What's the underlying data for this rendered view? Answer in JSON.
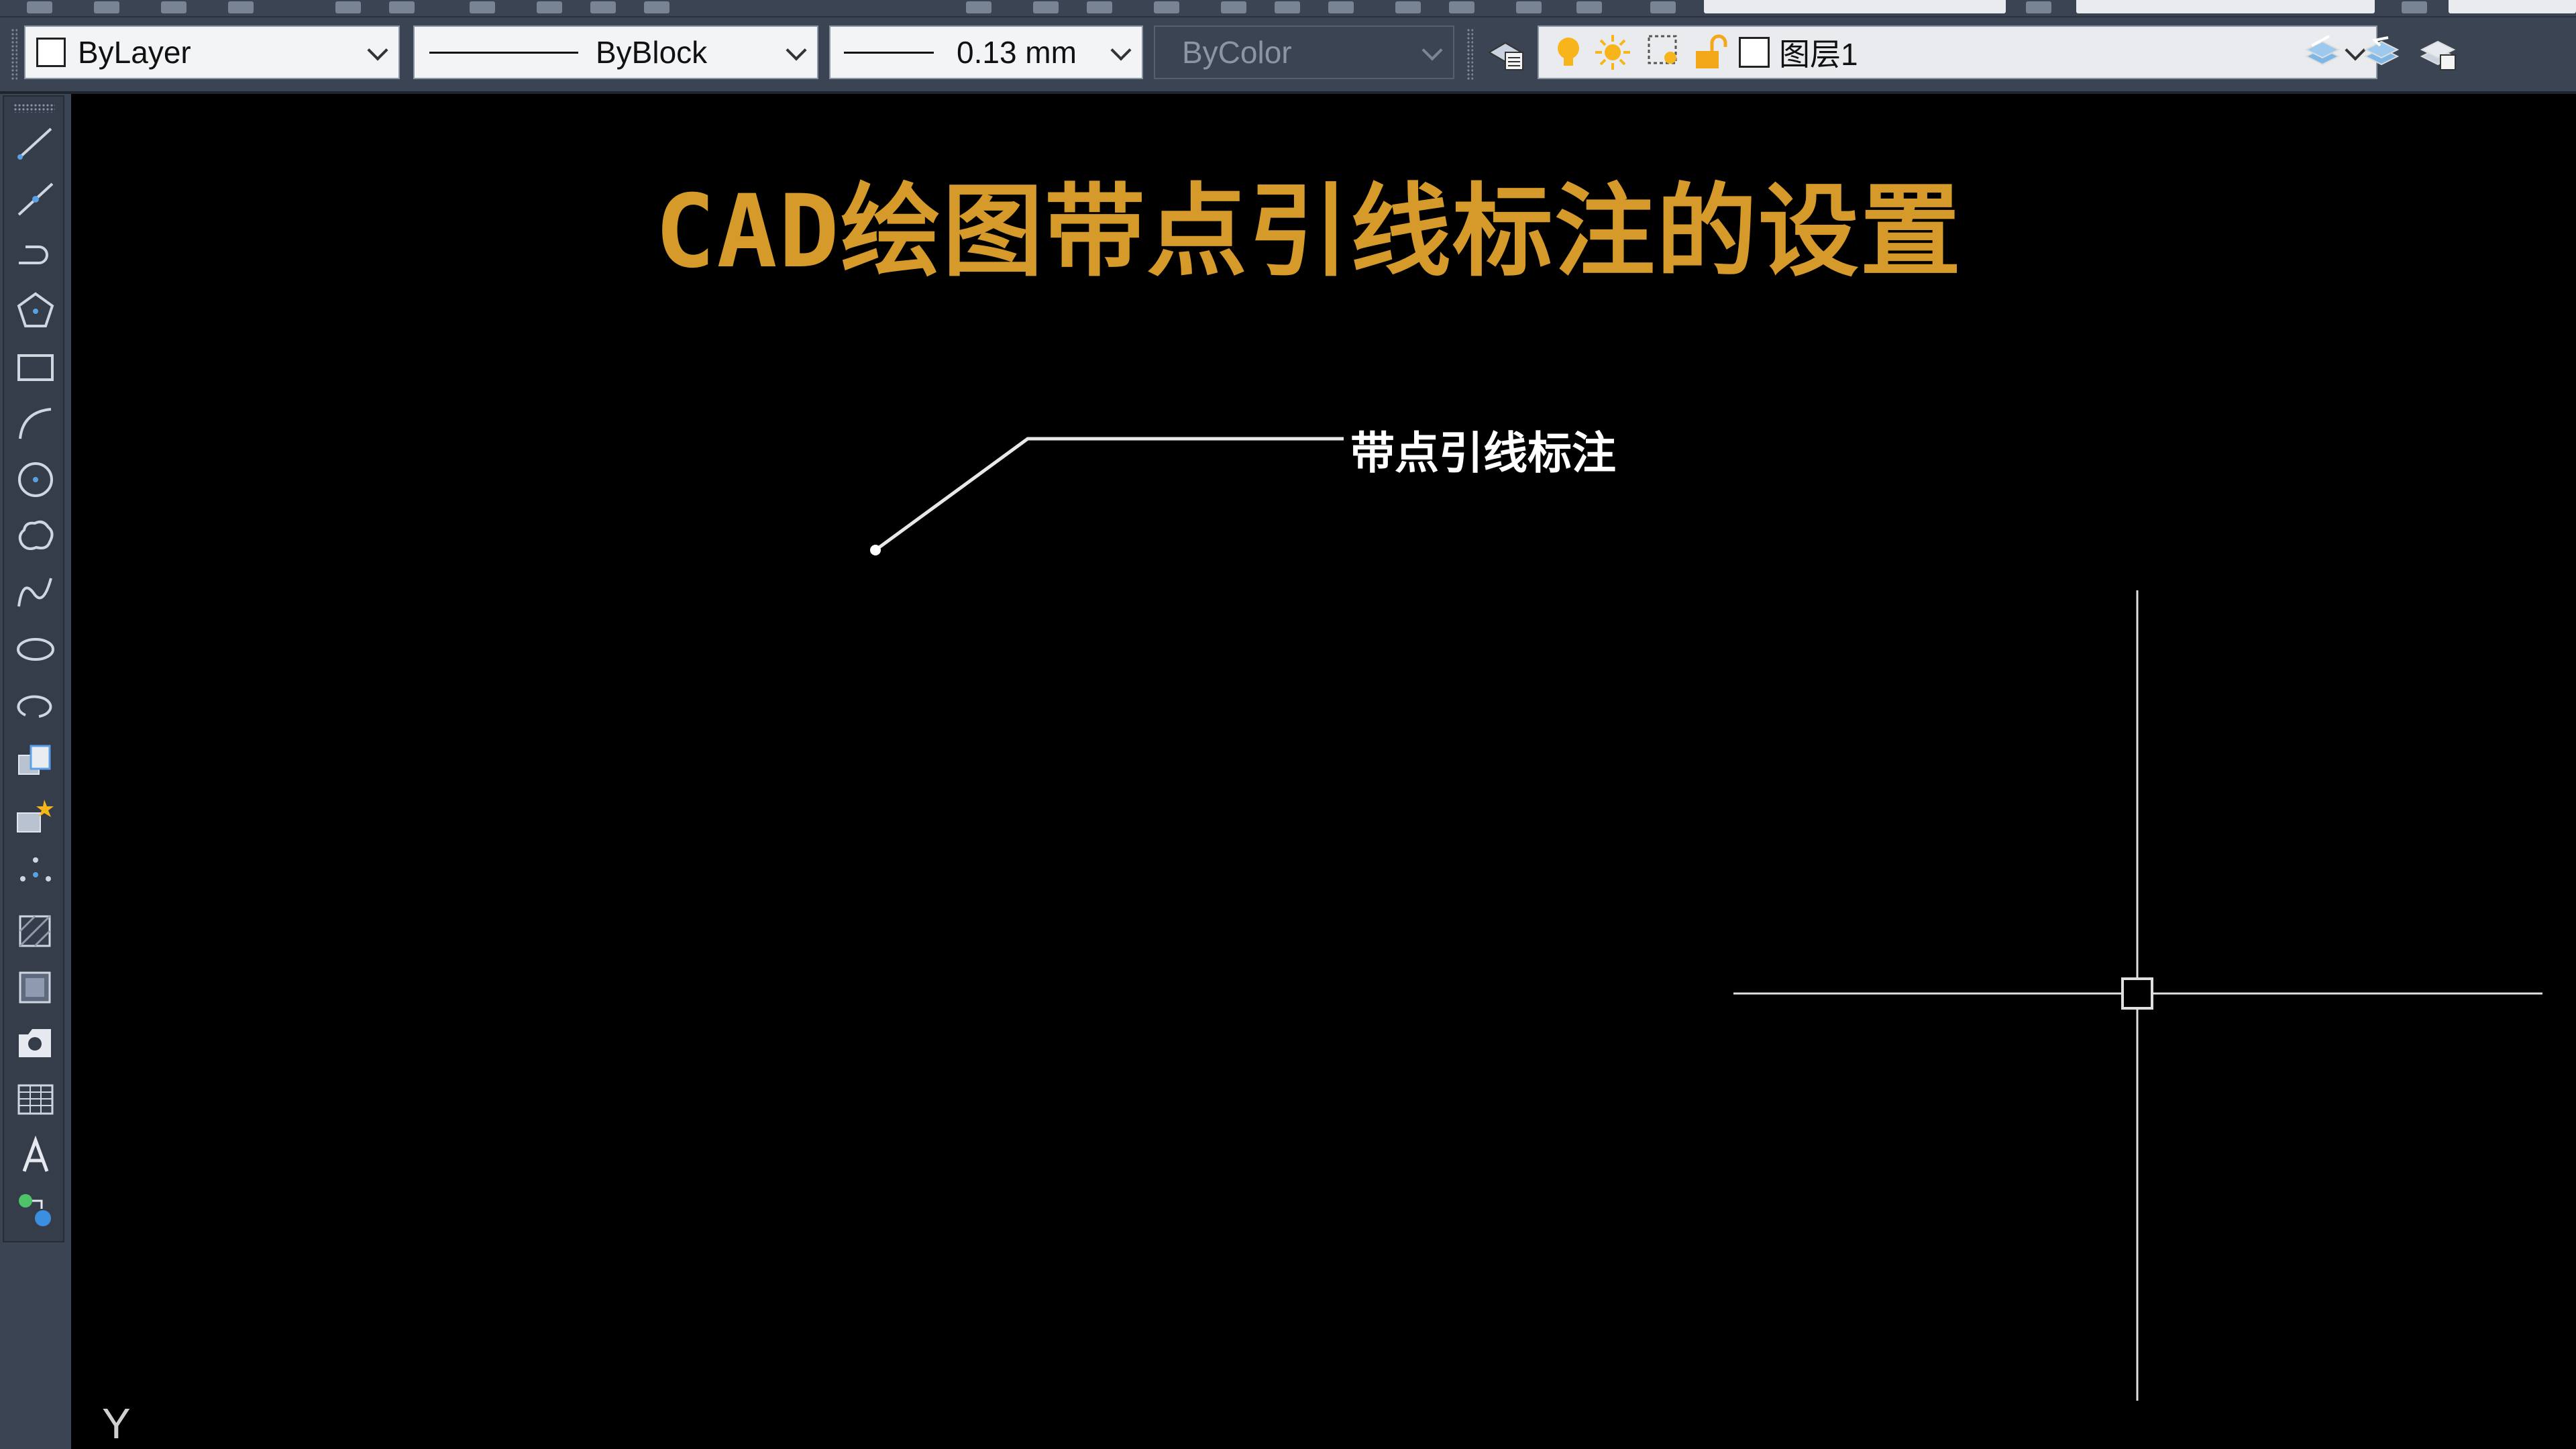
{
  "properties_toolbar": {
    "color_value": "ByLayer",
    "linetype_value": "ByBlock",
    "lineweight_value": "0.13 mm",
    "plotstyle_value": "ByColor",
    "layer_value": "图层1"
  },
  "drawing": {
    "title": "CAD绘图带点引线标注的设置",
    "leader_label": "带点引线标注",
    "ucs_y_label": "Y"
  },
  "colors": {
    "canvas_background": "#000000",
    "title_color": "#d59a2a",
    "toolbar_background": "#3b4453",
    "drawing_lines": "#ffffff"
  },
  "left_toolbar_tools": [
    "line-icon",
    "construction-line-icon",
    "polyline-icon",
    "polygon-icon",
    "rectangle-icon",
    "arc-icon",
    "circle-icon",
    "revision-cloud-icon",
    "spline-icon",
    "ellipse-icon",
    "ellipse-arc-icon",
    "insert-block-icon",
    "make-block-icon",
    "point-icon",
    "hatch-icon",
    "region-icon",
    "gradient-icon",
    "table-icon",
    "multiline-text-icon",
    "add-selected-icon"
  ]
}
